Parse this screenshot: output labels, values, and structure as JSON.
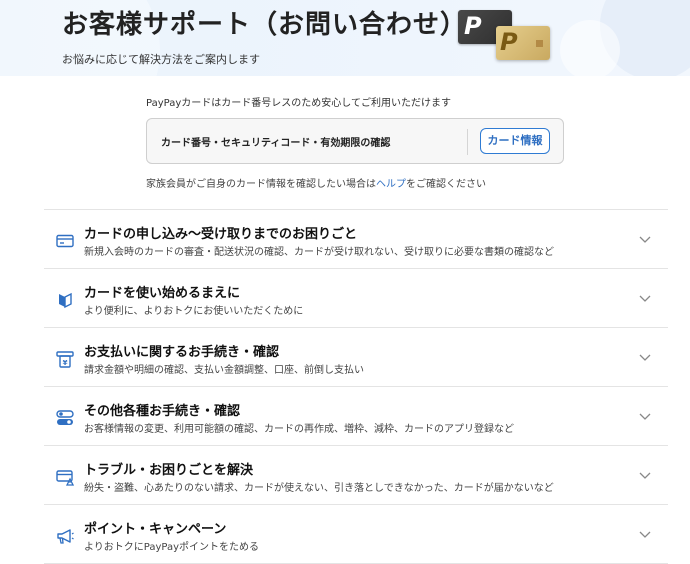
{
  "header": {
    "title": "お客様サポート（お問い合わせ）",
    "subtitle": "お悩みに応じて解決方法をご案内します"
  },
  "card_info": {
    "notice": "PayPayカードはカード番号レスのため安心してご利用いただけます",
    "box_label": "カード番号・セキュリティコード・有効期限の確認",
    "button_label": "カード情報",
    "family_note_before": "家族会員がご自身のカード情報を確認したい場合は",
    "family_note_link": "ヘルプ",
    "family_note_after": "をご確認ください"
  },
  "categories": [
    {
      "icon": "credit-card-icon",
      "title": "カードの申し込み〜受け取りまでのお困りごと",
      "desc": "新規入会時のカードの審査・配送状況の確認、カードが受け取れない、受け取りに必要な書類の確認など"
    },
    {
      "icon": "beginner-mark-icon",
      "title": "カードを使い始めるまえに",
      "desc": "より便利に、よりおトクにお使いいただくために"
    },
    {
      "icon": "payment-icon",
      "title": "お支払いに関するお手続き・確認",
      "desc": "請求金額や明細の確認、支払い金額調整、口座、前倒し支払い"
    },
    {
      "icon": "settings-toggle-icon",
      "title": "その他各種お手続き・確認",
      "desc": "お客様情報の変更、利用可能額の確認、カードの再作成、増枠、減枠、カードのアプリ登録など"
    },
    {
      "icon": "card-warning-icon",
      "title": "トラブル・お困りごとを解決",
      "desc": "紛失・盗難、心あたりのない請求、カードが使えない、引き落としできなかった、カードが届かないなど"
    },
    {
      "icon": "megaphone-icon",
      "title": "ポイント・キャンペーン",
      "desc": "よりおトクにPayPayポイントをためる"
    }
  ],
  "colors": {
    "accent": "#2f6fc2",
    "icon": "#2f6fc2"
  }
}
